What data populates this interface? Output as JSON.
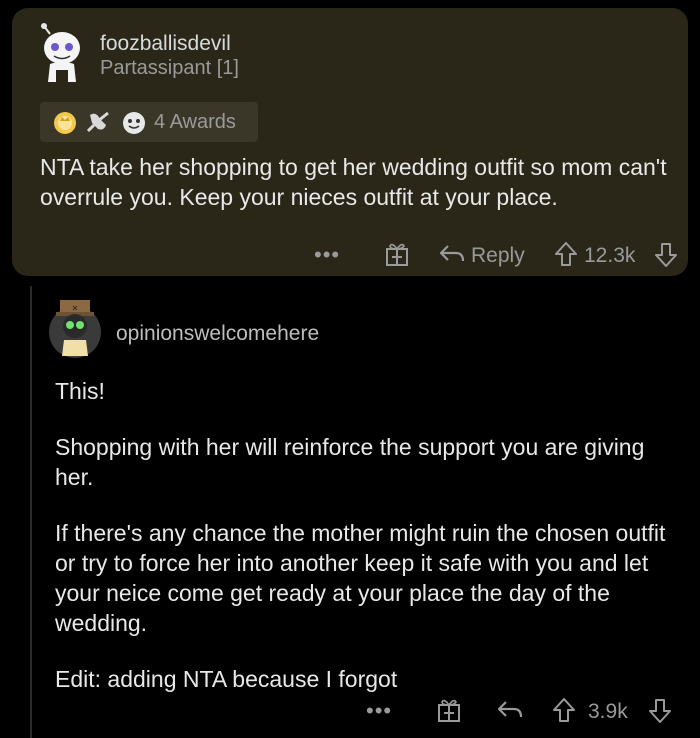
{
  "comment1": {
    "username": "foozballisdevil",
    "flair": "Partassipant [1]",
    "awards_label": "4 Awards",
    "body": "NTA take her shopping to get her wedding outfit so mom can't overrule you. Keep your nieces outfit at your place.",
    "more": "•••",
    "reply_label": "Reply",
    "score": "12.3k"
  },
  "comment2": {
    "username": "opinionswelcomehere",
    "paragraphs": [
      "This!",
      "Shopping with her will reinforce the support you are giving her.",
      "If there's any chance the mother might ruin the chosen outfit or try to force her into another keep it safe with you and let your neice come get ready at your place the day of the wedding.",
      "Edit: adding NTA because I forgot"
    ],
    "more": "•••",
    "score": "3.9k"
  },
  "icons": {
    "award1": "crown-award-icon",
    "award2": "hands-award-icon",
    "award3": "face-award-icon",
    "gift": "gift-icon",
    "reply": "reply-arrow-icon",
    "upvote": "upvote-arrow-icon",
    "downvote": "downvote-arrow-icon"
  },
  "colors": {
    "background": "#000000",
    "highlight_card": "#2b2718",
    "text": "#e8e8e8",
    "muted": "#9a9a9a"
  }
}
